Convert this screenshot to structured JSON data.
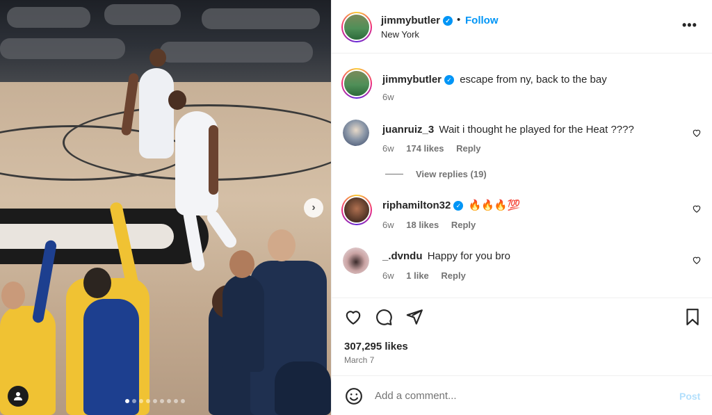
{
  "post": {
    "author": "jimmybutler",
    "location": "New York",
    "follow_label": "Follow",
    "separator": "•",
    "more_label": "•••",
    "caption": "escape from ny, back to the bay",
    "caption_age": "6w",
    "likes": "307,295 likes",
    "date": "March 7",
    "carousel": {
      "slide_count": 9,
      "active_slide": 1,
      "next_label": "›"
    }
  },
  "comments": [
    {
      "user": "juanruiz_3",
      "text": "Wait i thought he played for the Heat ????",
      "age": "6w",
      "likes": "174 likes",
      "reply": "Reply",
      "verified": false
    },
    {
      "user": "riphamilton32",
      "text": "🔥🔥🔥💯",
      "age": "6w",
      "likes": "18 likes",
      "reply": "Reply",
      "verified": true
    },
    {
      "user": "_.dvndu",
      "text": "Happy for you bro",
      "age": "6w",
      "likes": "1 like",
      "reply": "Reply",
      "verified": false
    }
  ],
  "view_replies": "View replies (19)",
  "composer": {
    "placeholder": "Add a comment...",
    "post_label": "Post"
  },
  "colors": {
    "accent": "#0095f6",
    "muted": "#737373",
    "post_disabled": "#b2dffc"
  },
  "icons": [
    "heart-icon",
    "comment-icon",
    "share-icon",
    "bookmark-icon",
    "emoji-icon",
    "more-icon",
    "verified-icon",
    "user-tag-icon",
    "chevron-right-icon"
  ]
}
